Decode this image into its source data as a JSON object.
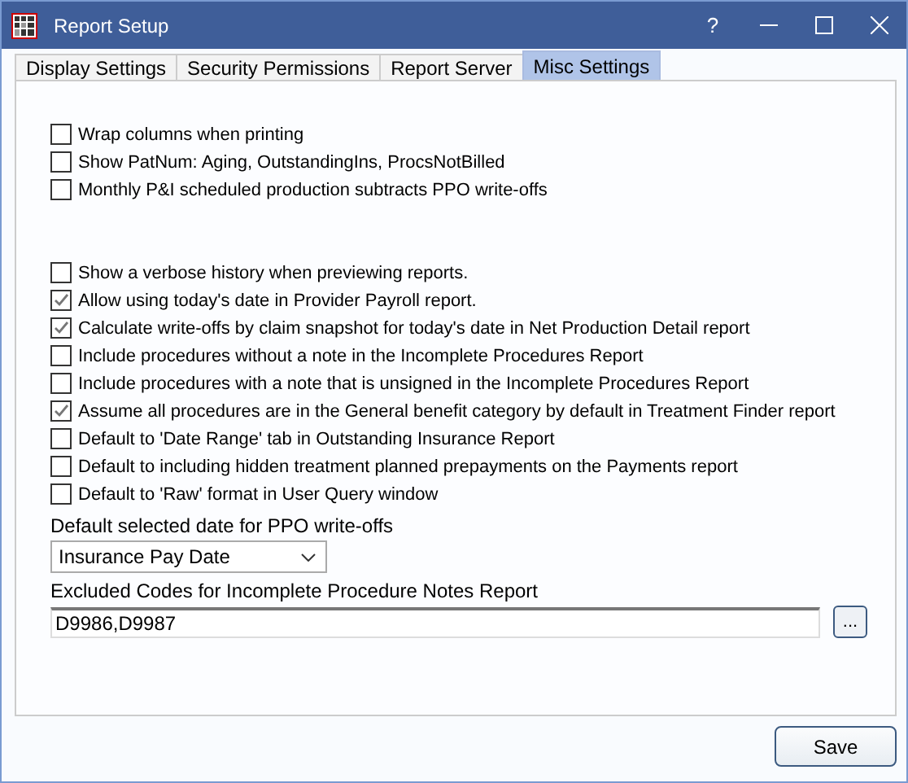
{
  "window": {
    "title": "Report Setup",
    "controls": [
      "?"
    ]
  },
  "tabs": [
    {
      "label": "Display Settings",
      "selected": false
    },
    {
      "label": "Security Permissions",
      "selected": false
    },
    {
      "label": "Report Server",
      "selected": false
    },
    {
      "label": "Misc Settings",
      "selected": true
    }
  ],
  "option_groups": [
    [
      {
        "label": "Wrap columns when printing",
        "checked": false
      },
      {
        "label": "Show PatNum: Aging, OutstandingIns, ProcsNotBilled",
        "checked": false
      },
      {
        "label": "Monthly P&I scheduled production subtracts PPO write-offs",
        "checked": false
      }
    ],
    [
      {
        "label": "Show a verbose history when previewing reports.",
        "checked": false
      },
      {
        "label": "Allow using today's date in Provider Payroll report.",
        "checked": true
      },
      {
        "label": "Calculate write-offs by claim snapshot for today's date in Net Production Detail report",
        "checked": true
      },
      {
        "label": "Include procedures without a note in the Incomplete Procedures Report",
        "checked": false
      },
      {
        "label": "Include procedures with a note that is unsigned in the Incomplete Procedures Report",
        "checked": false
      },
      {
        "label": "Assume all procedures are in the General benefit category by default in Treatment Finder report",
        "checked": true
      },
      {
        "label": "Default to 'Date Range' tab in Outstanding Insurance Report",
        "checked": false
      },
      {
        "label": "Default to including hidden treatment planned prepayments on the Payments report",
        "checked": false
      },
      {
        "label": "Default to 'Raw' format  in User Query window",
        "checked": false
      }
    ]
  ],
  "ppo_date": {
    "label": "Default selected date for PPO write-offs",
    "value": "Insurance Pay Date"
  },
  "excluded_codes": {
    "label": "Excluded Codes for Incomplete Procedure Notes Report",
    "value": "D9986,D9987",
    "button": "..."
  },
  "buttons": [
    "Save"
  ]
}
